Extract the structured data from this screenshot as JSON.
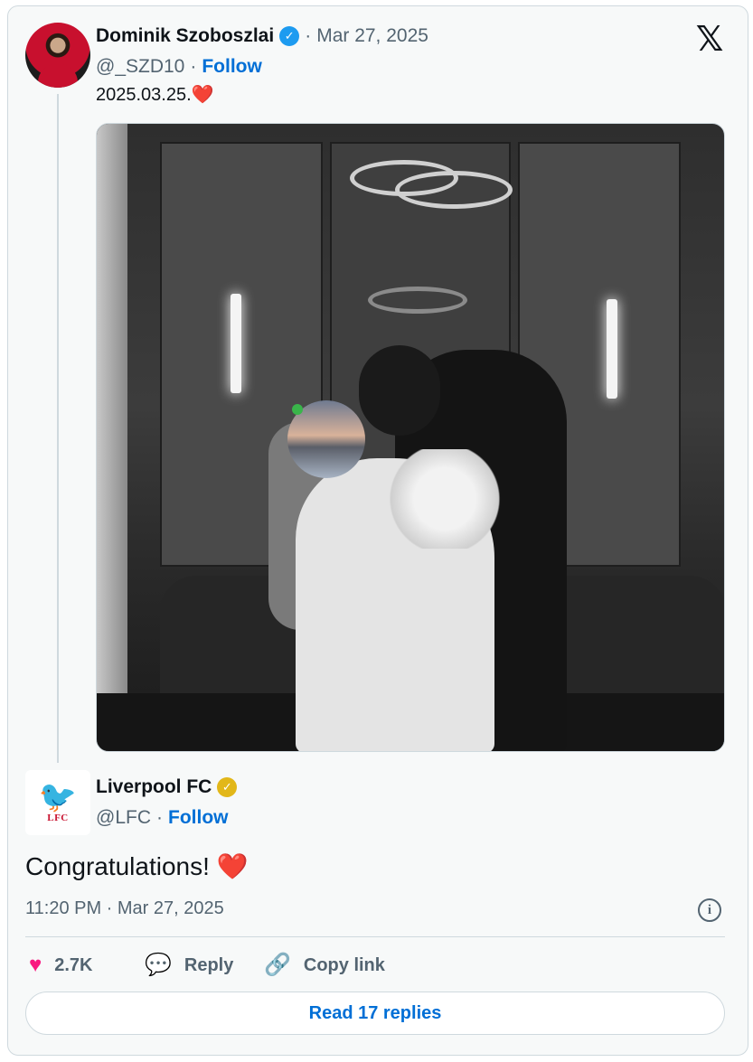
{
  "original_tweet": {
    "author_name": "Dominik Szoboszlai",
    "date_separator": "·",
    "date": "Mar 27, 2025",
    "handle": "@_SZD10",
    "handle_separator": "·",
    "follow_label": "Follow",
    "text": "2025.03.25.",
    "text_emoji": "❤️",
    "verified_badge": "blue-verified-icon",
    "verified_color": "#1d9bf0"
  },
  "reply_tweet": {
    "author_name": "Liverpool FC",
    "handle": "@LFC",
    "handle_separator": "·",
    "follow_label": "Follow",
    "text": "Congratulations!",
    "text_emoji": "❤️",
    "verified_badge": "gold-verified-icon",
    "verified_color": "#e2b719",
    "timestamp": "11:20 PM · Mar 27, 2025"
  },
  "actions": {
    "like_count": "2.7K",
    "reply_label": "Reply",
    "copy_link_label": "Copy link"
  },
  "read_replies_label": "Read 17 replies",
  "colors": {
    "link": "#006fd6",
    "like": "#f91880",
    "reply": "#1d9bf0",
    "muted": "#536471"
  }
}
